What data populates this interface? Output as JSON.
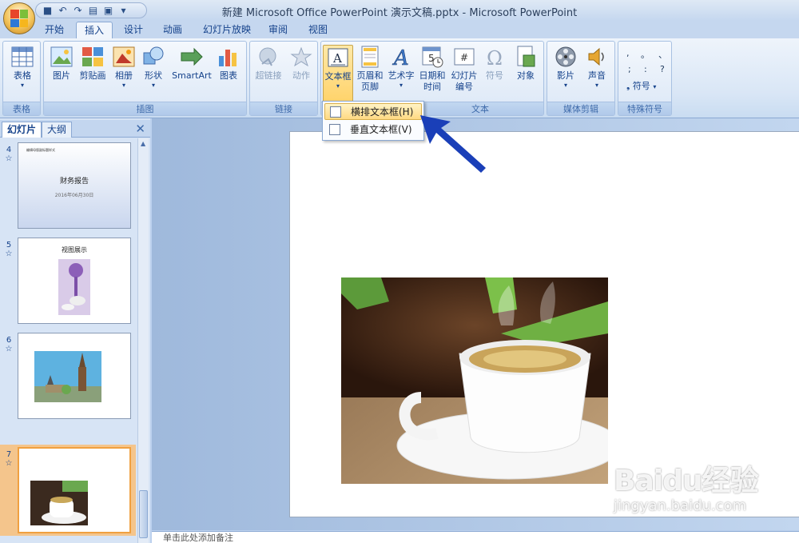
{
  "window": {
    "title": "新建 Microsoft Office PowerPoint 演示文稿.pptx - Microsoft PowerPoint"
  },
  "tabs": [
    "开始",
    "插入",
    "设计",
    "动画",
    "幻灯片放映",
    "审阅",
    "视图"
  ],
  "active_tab": "插入",
  "ribbon": {
    "groups": {
      "tables": "表格",
      "illustrations": "插图",
      "links": "链接",
      "text": "文本",
      "media": "媒体剪辑",
      "special": "特殊符号"
    },
    "buttons": {
      "table": "表格",
      "picture": "图片",
      "clipart": "剪贴画",
      "album": "相册",
      "shapes": "形状",
      "smartart": "SmartArt",
      "chart": "图表",
      "hyperlink": "超链接",
      "action": "动作",
      "textbox": "文本框",
      "header_line1": "页眉和",
      "header_line2": "页脚",
      "wordart": "艺术字",
      "datetime_line1": "日期和",
      "datetime_line2": "时间",
      "slidenum_line1": "幻灯片",
      "slidenum_line2": "编号",
      "symbol": "符号",
      "object": "对象",
      "movie": "影片",
      "sound": "声音",
      "special_symbol": "符号"
    },
    "special_chars": [
      ",",
      "。",
      "、",
      ";",
      ":",
      "?"
    ]
  },
  "dropdown": {
    "items": [
      "横排文本框(H)",
      "垂直文本框(V)"
    ]
  },
  "panel": {
    "tabs": [
      "幻灯片",
      "大纲"
    ]
  },
  "thumbnails": [
    {
      "num": "4",
      "title_small": "编辑母版副标题样式",
      "title": "财务报告",
      "subtitle": "2016年06月30日"
    },
    {
      "num": "5",
      "title": "视图展示"
    },
    {
      "num": "6"
    },
    {
      "num": "7"
    }
  ],
  "thumb_suffix": "☆",
  "notes": {
    "placeholder": "单击此处添加备注"
  },
  "watermark": {
    "logo": "Baidu经验",
    "url": "jingyan.baidu.com"
  }
}
